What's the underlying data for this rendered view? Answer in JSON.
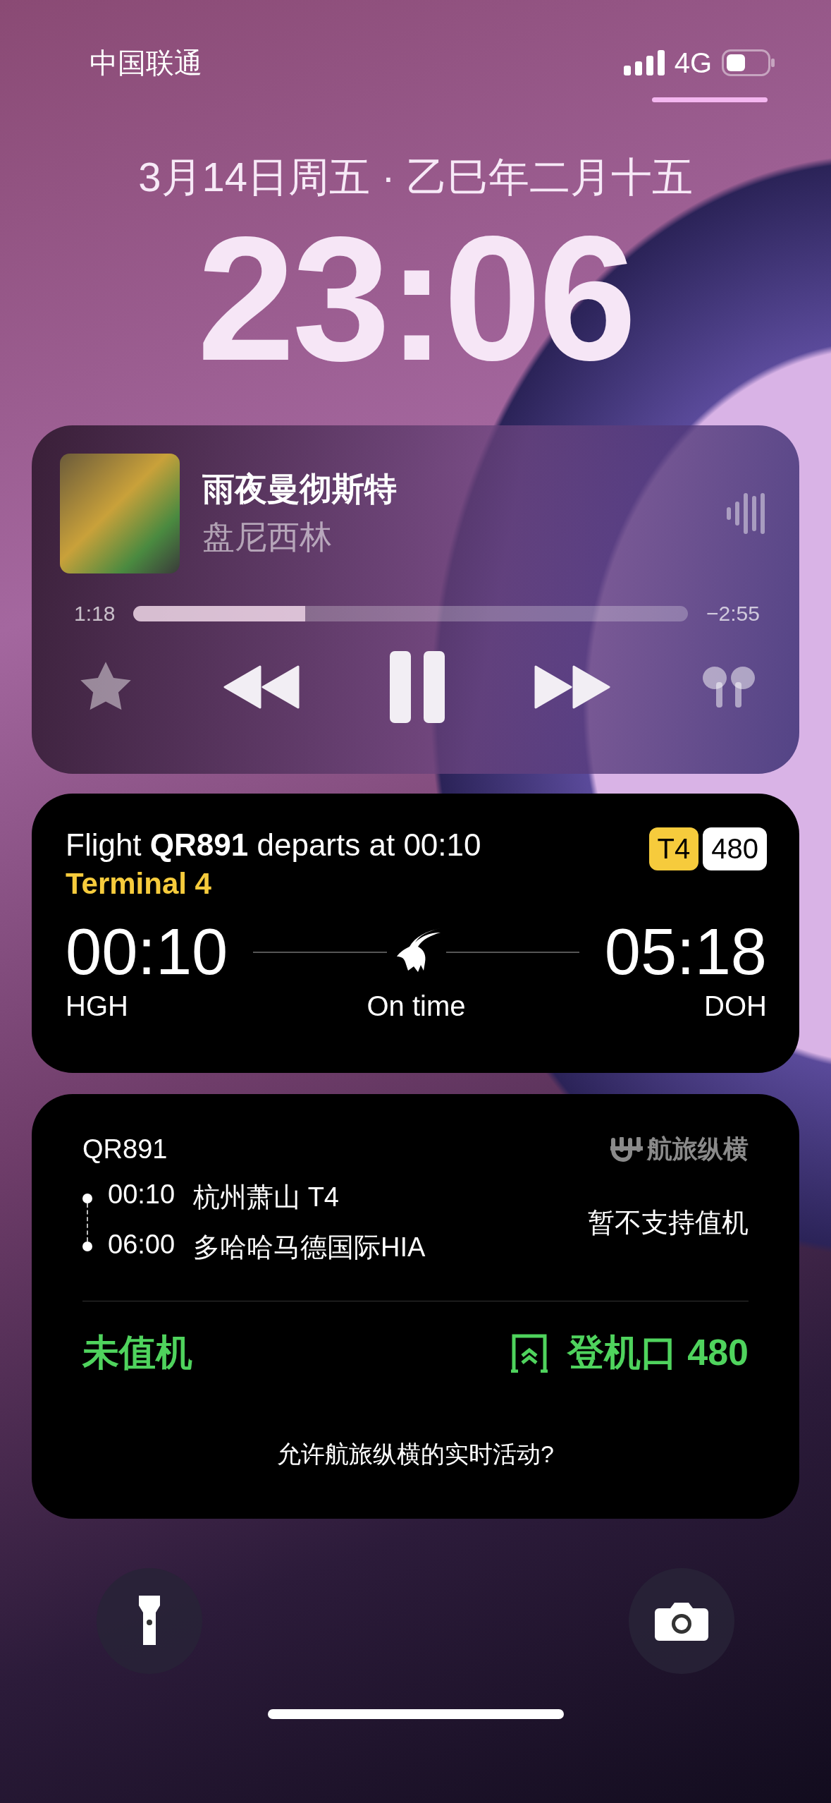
{
  "status_bar": {
    "carrier": "中国联通",
    "network": "4G"
  },
  "lock": {
    "date": "3月14日周五 · 乙巳年二月十五",
    "time": "23:06"
  },
  "now_playing": {
    "title": "雨夜曼彻斯特",
    "artist": "盘尼西林",
    "elapsed": "1:18",
    "remaining": "−2:55",
    "level": 0.31,
    "playing": true
  },
  "flight_activity": {
    "headline": "Flight **QR891** departs at 00:10",
    "terminal": "Terminal 4",
    "badges": [
      {
        "label": "T4",
        "color": "#f6cb3c"
      },
      {
        "label": "480",
        "color": "#ffffff"
      }
    ],
    "departure": {
      "time": "00:10",
      "code": "HGH"
    },
    "status": "On time",
    "arrival": {
      "time": "05:18",
      "code": "DOH"
    }
  },
  "trip_card": {
    "flight": "QR891",
    "app_name": "航旅纵横",
    "stops": [
      {
        "time": "00:10",
        "place": "杭州萧山 T4"
      },
      {
        "time": "06:00",
        "place": "多哈哈马德国际HIA"
      }
    ],
    "checkin_note": "暂不支持值机",
    "checkin_status": "未值机",
    "gate": "登机口 480",
    "prompt": "允许航旅纵横的实时活动?"
  }
}
